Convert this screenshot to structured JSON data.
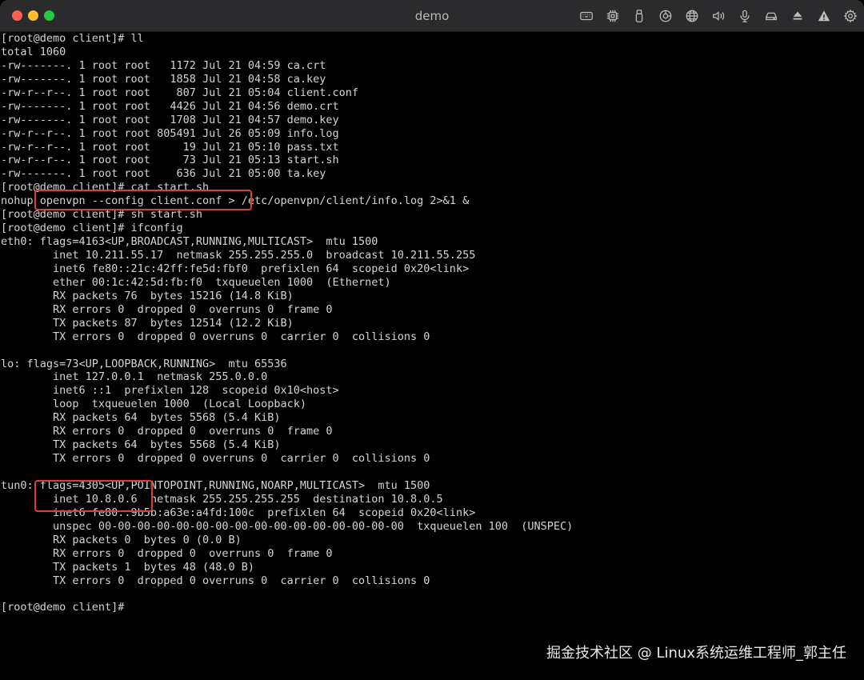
{
  "window": {
    "title": "demo"
  },
  "toolbar": {
    "icons": [
      "keyboard-icon",
      "cpu-icon",
      "usb-icon",
      "shared-folder-icon",
      "network-icon",
      "volume-icon",
      "microphone-icon",
      "disk-icon",
      "eject-icon",
      "warning-icon",
      "settings-icon"
    ]
  },
  "terminal": {
    "lines": [
      "[root@demo client]# ll",
      "total 1060",
      "-rw-------. 1 root root   1172 Jul 21 04:59 ca.crt",
      "-rw-------. 1 root root   1858 Jul 21 04:58 ca.key",
      "-rw-r--r--. 1 root root    807 Jul 21 05:04 client.conf",
      "-rw-------. 1 root root   4426 Jul 21 04:56 demo.crt",
      "-rw-------. 1 root root   1708 Jul 21 04:57 demo.key",
      "-rw-r--r--. 1 root root 805491 Jul 26 05:09 info.log",
      "-rw-r--r--. 1 root root     19 Jul 21 05:10 pass.txt",
      "-rw-r--r--. 1 root root     73 Jul 21 05:13 start.sh",
      "-rw-------. 1 root root    636 Jul 21 05:00 ta.key",
      "[root@demo client]# cat start.sh",
      "nohup openvpn --config client.conf > /etc/openvpn/client/info.log 2>&1 &",
      "[root@demo client]# sh start.sh",
      "[root@demo client]# ifconfig",
      "eth0: flags=4163<UP,BROADCAST,RUNNING,MULTICAST>  mtu 1500",
      "        inet 10.211.55.17  netmask 255.255.255.0  broadcast 10.211.55.255",
      "        inet6 fe80::21c:42ff:fe5d:fbf0  prefixlen 64  scopeid 0x20<link>",
      "        ether 00:1c:42:5d:fb:f0  txqueuelen 1000  (Ethernet)",
      "        RX packets 76  bytes 15216 (14.8 KiB)",
      "        RX errors 0  dropped 0  overruns 0  frame 0",
      "        TX packets 87  bytes 12514 (12.2 KiB)",
      "        TX errors 0  dropped 0 overruns 0  carrier 0  collisions 0",
      "",
      "lo: flags=73<UP,LOOPBACK,RUNNING>  mtu 65536",
      "        inet 127.0.0.1  netmask 255.0.0.0",
      "        inet6 ::1  prefixlen 128  scopeid 0x10<host>",
      "        loop  txqueuelen 1000  (Local Loopback)",
      "        RX packets 64  bytes 5568 (5.4 KiB)",
      "        RX errors 0  dropped 0  overruns 0  frame 0",
      "        TX packets 64  bytes 5568 (5.4 KiB)",
      "        TX errors 0  dropped 0 overruns 0  carrier 0  collisions 0",
      "",
      "tun0: flags=4305<UP,POINTOPOINT,RUNNING,NOARP,MULTICAST>  mtu 1500",
      "        inet 10.8.0.6  netmask 255.255.255.255  destination 10.8.0.5",
      "        inet6 fe80::9b5b:a63e:a4fd:100c  prefixlen 64  scopeid 0x20<link>",
      "        unspec 00-00-00-00-00-00-00-00-00-00-00-00-00-00-00-00  txqueuelen 100  (UNSPEC)",
      "        RX packets 0  bytes 0 (0.0 B)",
      "        RX errors 0  dropped 0  overruns 0  frame 0",
      "        TX packets 1  bytes 48 (48.0 B)",
      "        TX errors 0  dropped 0 overruns 0  carrier 0  collisions 0",
      "",
      "[root@demo client]#"
    ]
  },
  "watermark": {
    "text": "掘金技术社区 @ Linux系统运维工程师_郭主任"
  },
  "colors": {
    "terminal_bg": "#000000",
    "terminal_fg": "#d4d4d4",
    "highlight": "#e03b3b",
    "titlebar_bg": "#2b2b2d"
  }
}
